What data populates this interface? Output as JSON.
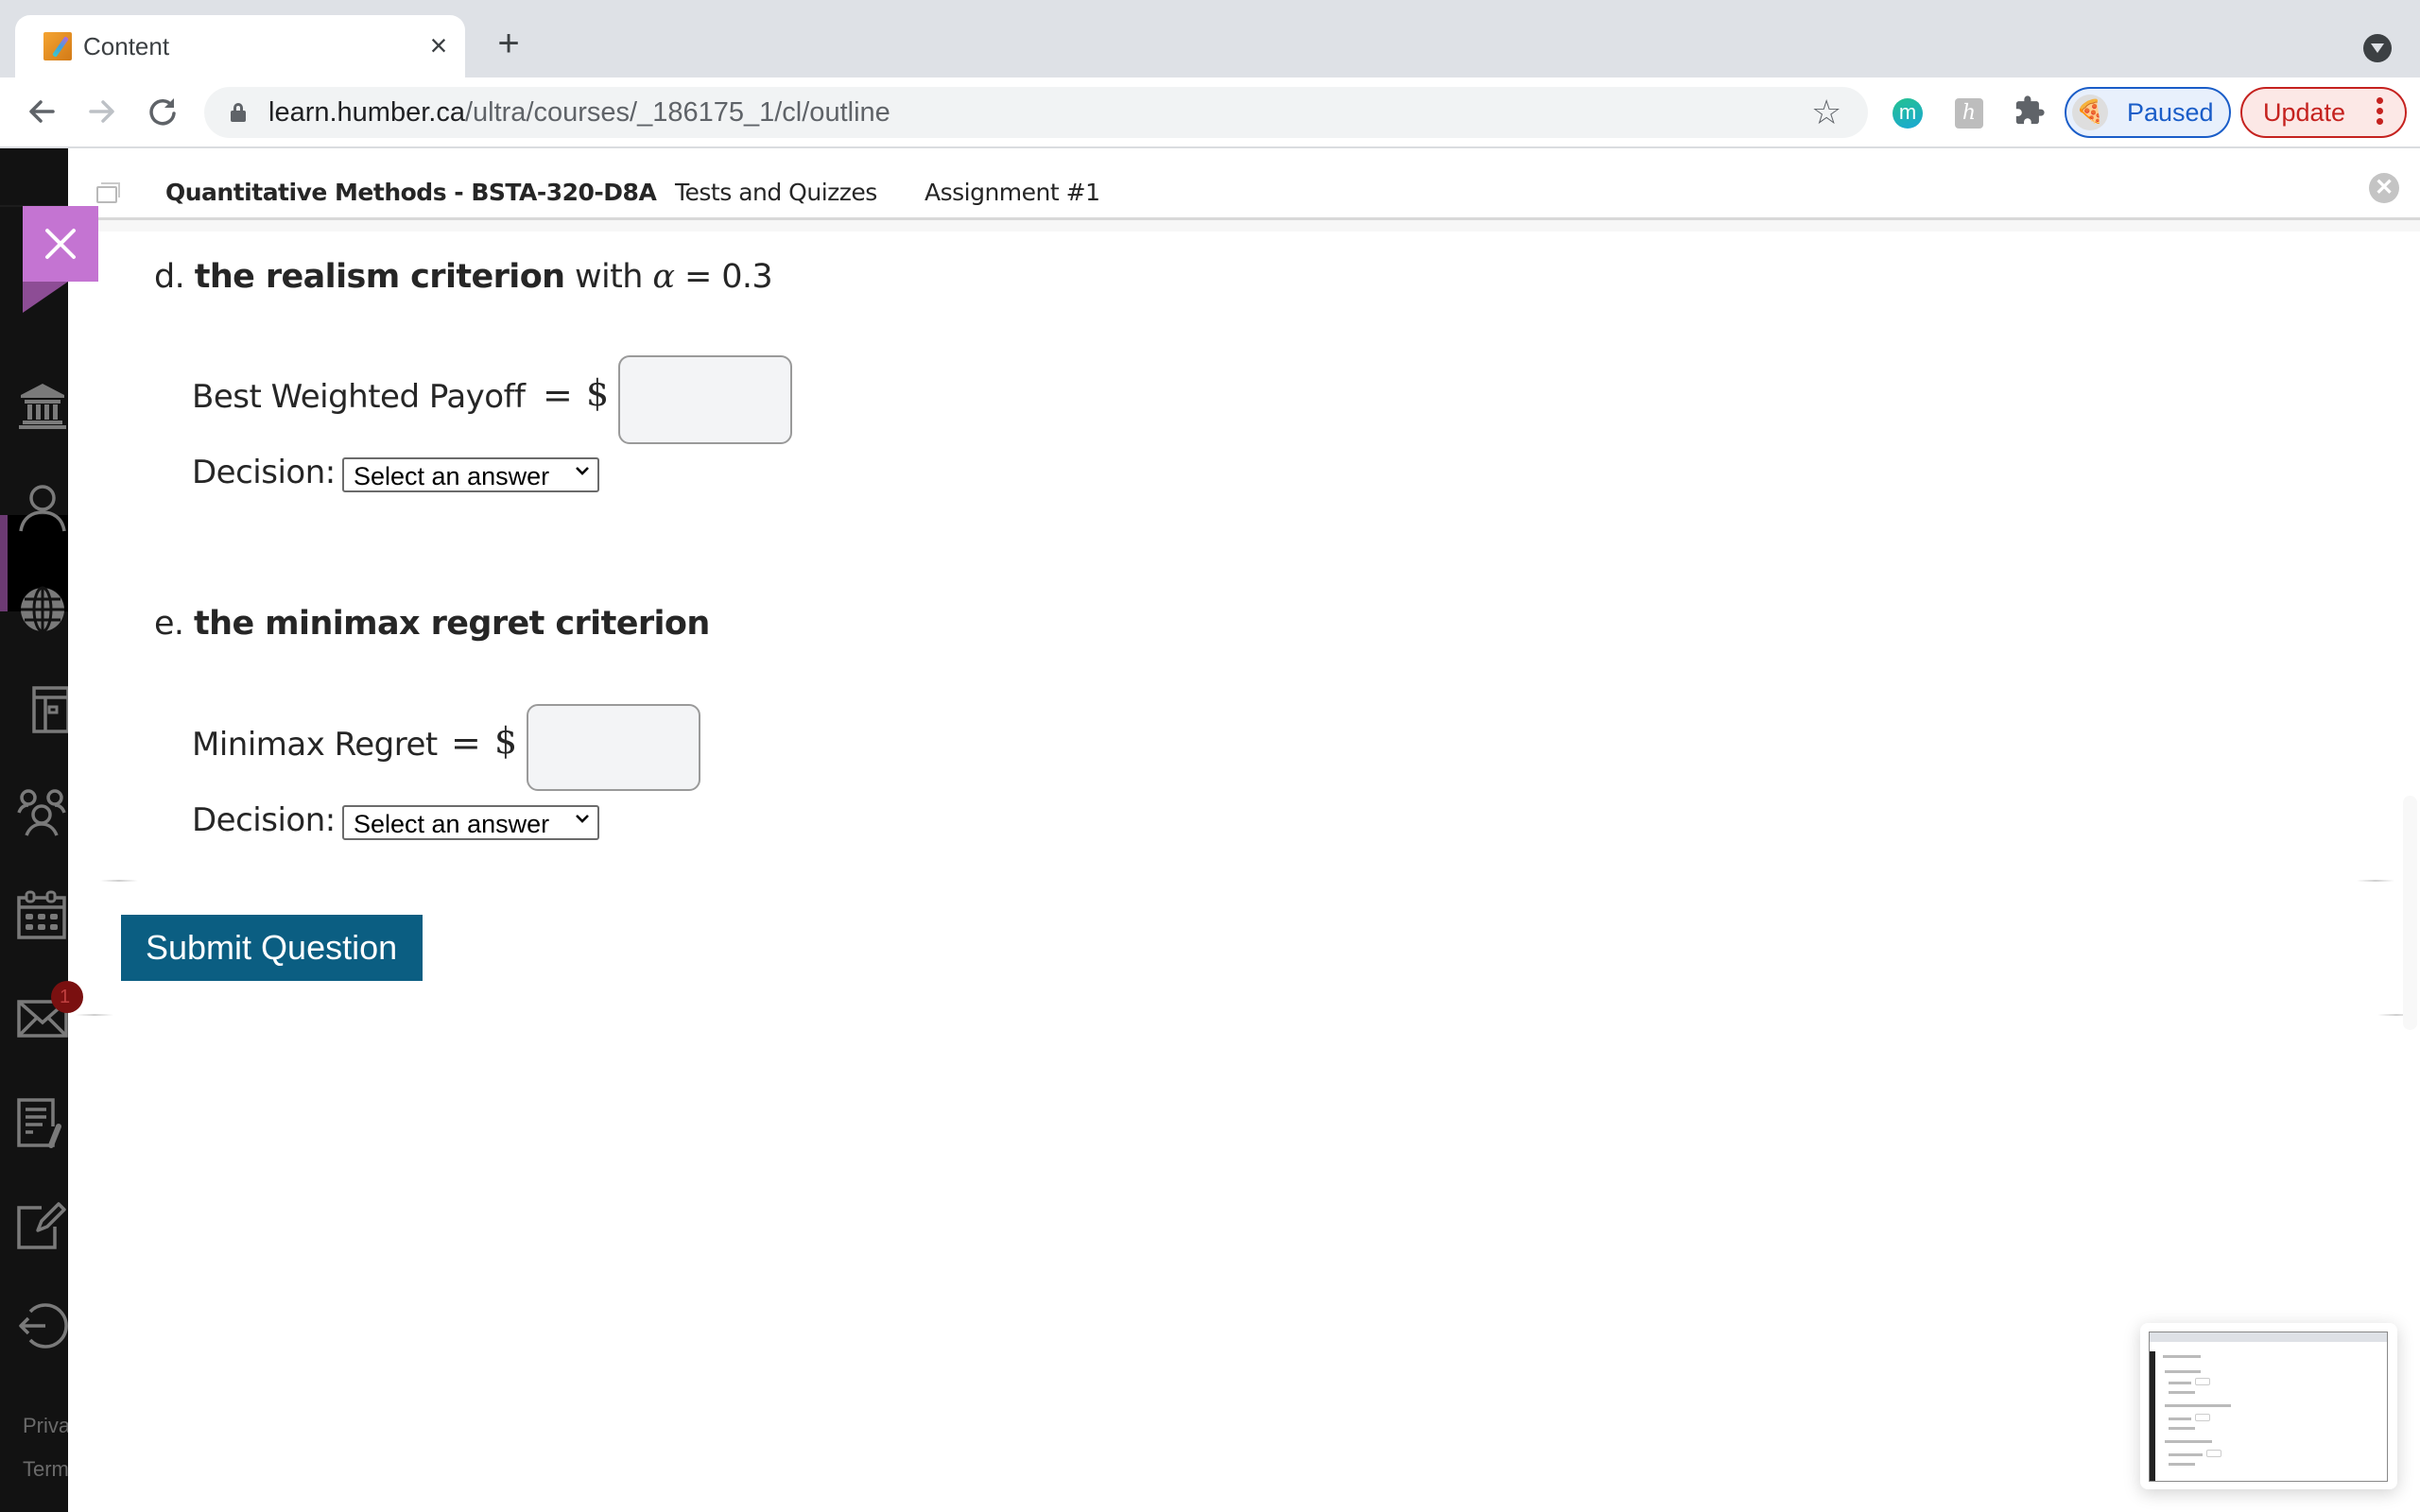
{
  "browser": {
    "tab_title": "Content",
    "url_host": "learn.humber.ca",
    "url_path": "/ultra/courses/_186175_1/cl/outline",
    "profile_label": "Paused",
    "update_label": "Update",
    "extensions": [
      "m",
      "h"
    ]
  },
  "course_header": {
    "course_title": "Quantitative Methods - BSTA-320-D8A",
    "crumb_2": "Tests and Quizzes",
    "crumb_3": "Assignment #1"
  },
  "sidebar": {
    "mail_badge": "1",
    "footer_links": [
      "Privacy",
      "Terms"
    ],
    "items": [
      "institution",
      "profile",
      "activity",
      "courses",
      "organizations",
      "calendar",
      "messages",
      "grades",
      "tools",
      "sign-out"
    ]
  },
  "questions": [
    {
      "letter": "d.",
      "title": "the realism criterion",
      "suffix_pre": "with",
      "alpha_symbol": "α",
      "suffix_post": "= 0.3",
      "field_label": "Best Weighted Payoff",
      "equals": "=",
      "currency": "$",
      "value": "",
      "decision_label": "Decision:",
      "decision_selected": "Select an answer"
    },
    {
      "letter": "e.",
      "title": "the minimax regret criterion",
      "field_label": "Minimax Regret",
      "equals": "=",
      "currency": "$",
      "value": "",
      "decision_label": "Decision:",
      "decision_selected": "Select an answer"
    }
  ],
  "submit_label": "Submit Question",
  "colors": {
    "submit_bg": "#0b5e82",
    "panel_close_bg": "#c474d2",
    "active_nav_accent": "#6c3a73",
    "profile_blue": "#1a5dc8",
    "update_red": "#c5221f"
  }
}
